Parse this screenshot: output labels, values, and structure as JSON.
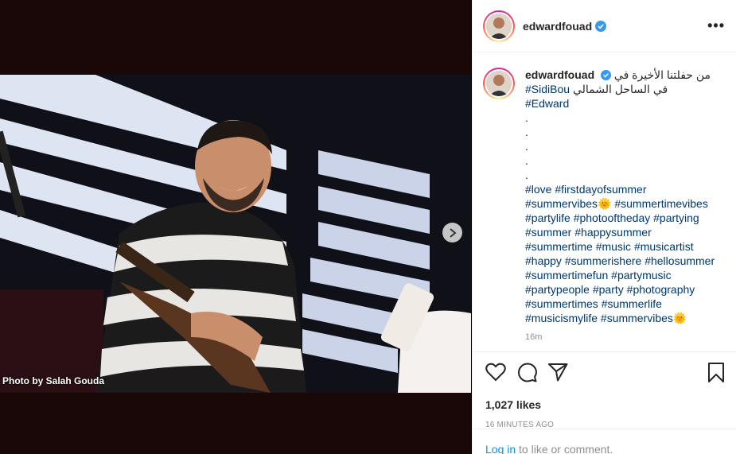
{
  "photo": {
    "credit": "Photo by Salah Gouda",
    "alt": "Photo"
  },
  "post": {
    "username": "edwardfouad",
    "more_label": "•••"
  },
  "caption": {
    "username": "edwardfouad",
    "line1": "من حفلتنا الأخيرة في",
    "tag_sidibou": "#SidiBou",
    "line2": "في الساحل الشمالي",
    "tag_edward": "#Edward",
    "dots": [
      ".",
      ".",
      ".",
      ".",
      "."
    ],
    "hashtag_lines": [
      [
        "#love",
        "#firstdayofsummer"
      ],
      [
        "#summervibes🌞",
        "#summertimevibes"
      ],
      [
        "#partylife",
        "#photooftheday",
        "#partying"
      ],
      [
        "#summer",
        "#happysummer"
      ],
      [
        "#summertime",
        "#music",
        "#musicartist"
      ],
      [
        "#happy",
        "#summerishere",
        "#hellosummer"
      ],
      [
        "#summertimefun",
        "#partymusic"
      ],
      [
        "#partypeople",
        "#party",
        "#photography"
      ],
      [
        "#summertimes",
        "#summerlife"
      ],
      [
        "#musicismylife",
        "#summervibes🌞"
      ]
    ],
    "time": "16m"
  },
  "actions": {
    "likes": "1,027 likes",
    "posted": "16 MINUTES AGO"
  },
  "login": {
    "link": "Log in",
    "rest": " to like or comment."
  }
}
